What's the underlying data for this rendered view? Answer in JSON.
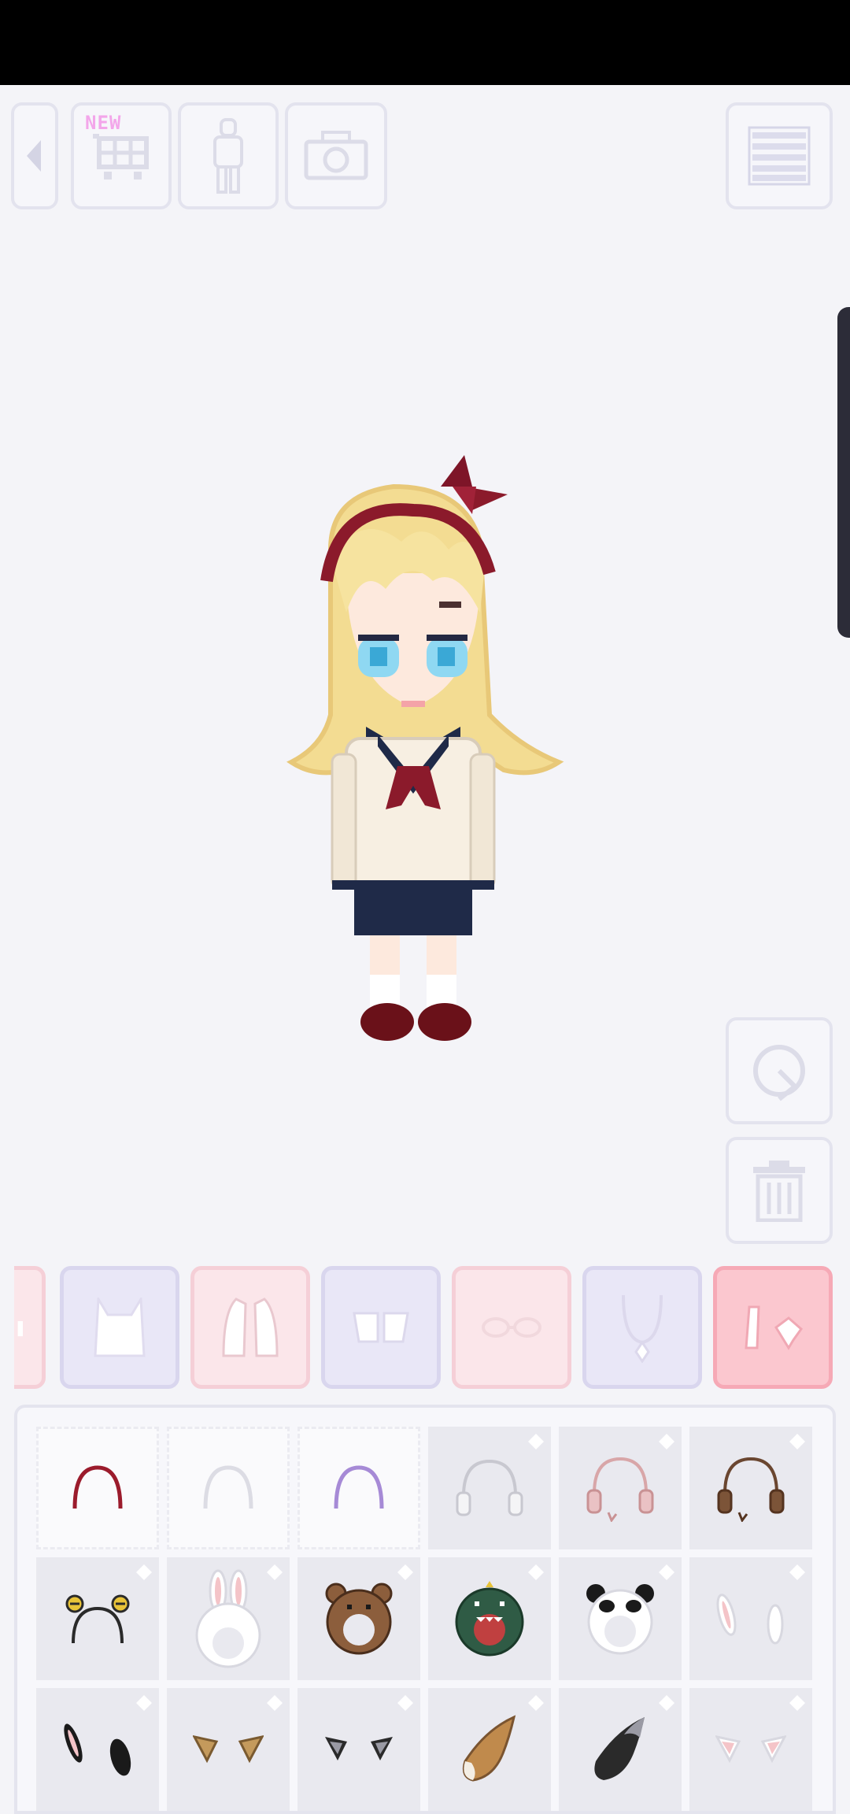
{
  "toolbar": {
    "new_badge": "NEW",
    "buttons": [
      "back-arrow-icon",
      "shop-cart-icon",
      "body-icon",
      "camera-icon",
      "menu-icon"
    ]
  },
  "character": {
    "description_icon": "avatar-character"
  },
  "actions": [
    "rotate-icon",
    "trash-icon"
  ],
  "category_tabs": [
    {
      "icon": "partial-icon",
      "style": "pink"
    },
    {
      "icon": "top-shirt-icon",
      "style": "lav"
    },
    {
      "icon": "jacket-icon",
      "style": "pink"
    },
    {
      "icon": "shorts-icon",
      "style": "lav"
    },
    {
      "icon": "glasses-icon",
      "style": "pink"
    },
    {
      "icon": "necklace-icon",
      "style": "lav"
    },
    {
      "icon": "headwear-ears-icon",
      "style": "active"
    }
  ],
  "colors": {
    "accent_pink": "#fbc7cf",
    "lavender": "#e9e7f7",
    "background": "#f4f4f8"
  },
  "items": [
    {
      "name": "red-headband",
      "locked": false
    },
    {
      "name": "white-headband",
      "locked": false
    },
    {
      "name": "purple-headband",
      "locked": false
    },
    {
      "name": "white-earmuffs",
      "locked": true
    },
    {
      "name": "pink-earmuffs",
      "locked": true
    },
    {
      "name": "brown-earmuffs",
      "locked": true
    },
    {
      "name": "bee-antenna-headband",
      "locked": true
    },
    {
      "name": "bunny-hood",
      "locked": true
    },
    {
      "name": "bear-hood",
      "locked": true
    },
    {
      "name": "dino-hood",
      "locked": true
    },
    {
      "name": "panda-hood",
      "locked": true
    },
    {
      "name": "white-bunny-ears",
      "locked": true
    },
    {
      "name": "black-bunny-ears",
      "locked": true
    },
    {
      "name": "tan-fox-ears",
      "locked": true
    },
    {
      "name": "black-cat-ears",
      "locked": true
    },
    {
      "name": "fox-tail",
      "locked": true
    },
    {
      "name": "black-tail",
      "locked": true
    },
    {
      "name": "white-cat-ears",
      "locked": true
    }
  ]
}
